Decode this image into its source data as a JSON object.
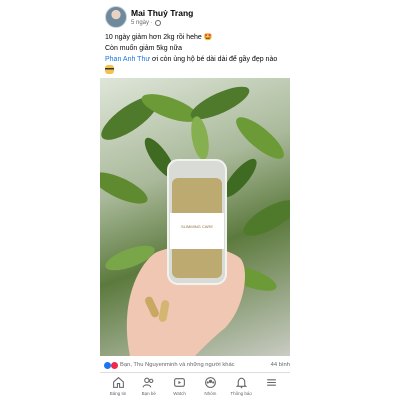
{
  "post": {
    "author": "Mai Thuỷ Trang",
    "time": "5 ngày ·",
    "privacy_icon": "globe-icon",
    "lines": [
      "10 ngày giảm hơn 2kg rồi hehe 🤩",
      "Còn muốn giảm 5kg nữa"
    ],
    "mention": "Phan Anh Thư",
    "mention_rest": " ơi còn ủng hộ bé dài dài để gầy đẹp nào",
    "product_label": "SLIMMING CARE"
  },
  "reactions": {
    "names": "Bạn, Thu Nguyenminh và những người khác",
    "comments": "44 bình"
  },
  "nav": {
    "items": [
      {
        "label": "Bảng tin",
        "icon": "home-icon"
      },
      {
        "label": "Bạn bè",
        "icon": "friends-icon"
      },
      {
        "label": "Watch",
        "icon": "watch-icon"
      },
      {
        "label": "Nhóm",
        "icon": "groups-icon"
      },
      {
        "label": "Thông báo",
        "icon": "bell-icon"
      },
      {
        "label": "",
        "icon": "menu-icon"
      }
    ]
  },
  "colors": {
    "accent": "#1877f2",
    "mention": "#1b74e4"
  }
}
